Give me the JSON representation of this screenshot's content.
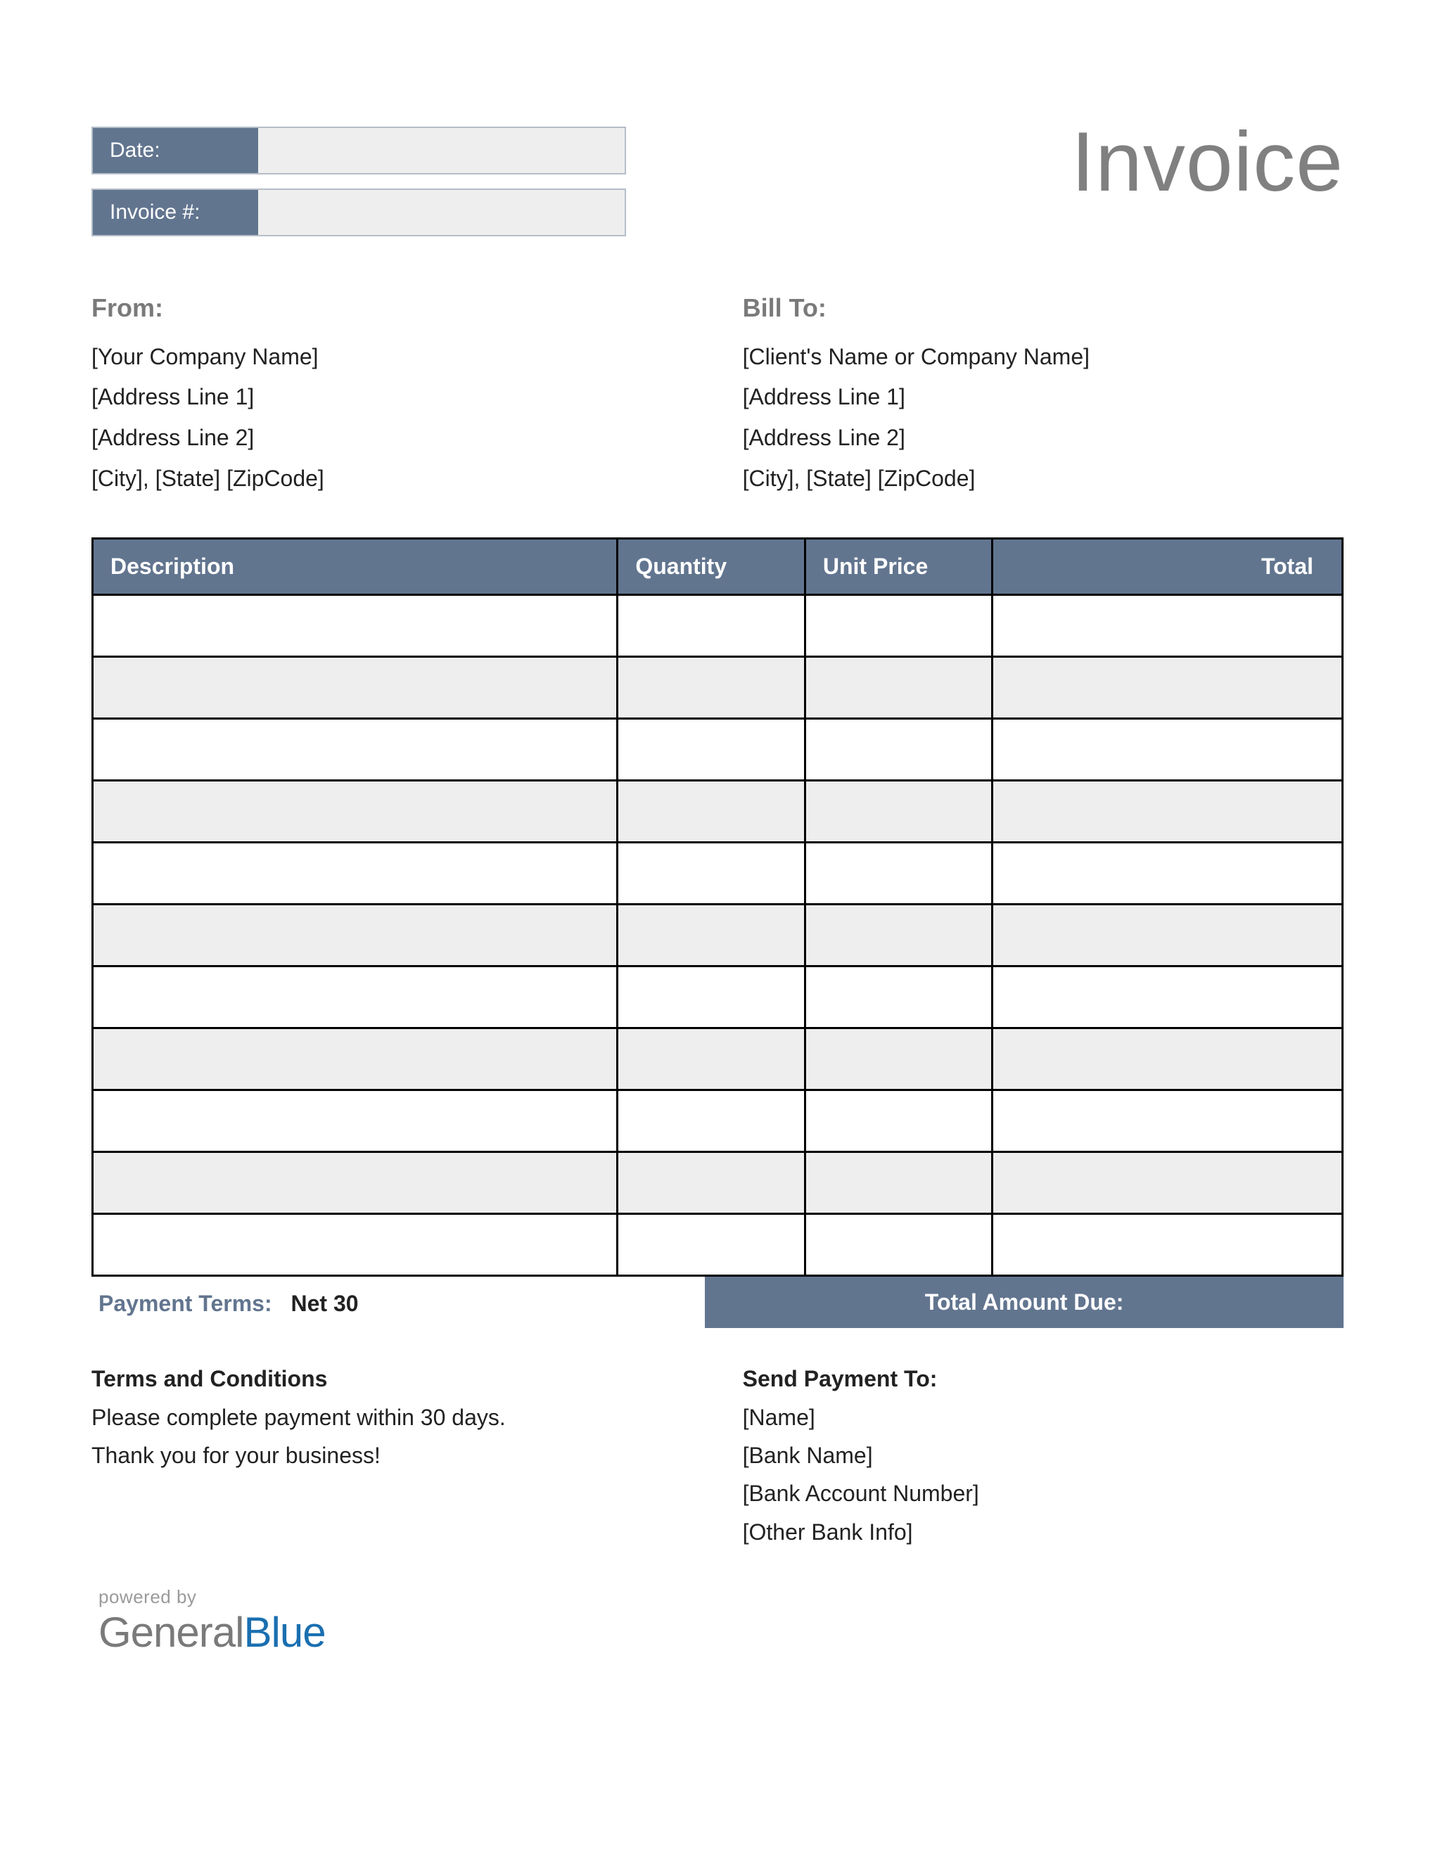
{
  "title": "Invoice",
  "meta": {
    "date_label": "Date:",
    "date_value": "",
    "invoice_no_label": "Invoice #:",
    "invoice_no_value": ""
  },
  "from": {
    "heading": "From:",
    "lines": [
      "[Your Company Name]",
      "[Address Line 1]",
      "[Address Line 2]",
      "[City], [State] [ZipCode]"
    ]
  },
  "bill_to": {
    "heading": "Bill To:",
    "lines": [
      "[Client's Name or Company Name]",
      "[Address Line 1]",
      "[Address Line 2]",
      "[City], [State] [ZipCode]"
    ]
  },
  "table": {
    "headers": [
      "Description",
      "Quantity",
      "Unit Price",
      "Total"
    ],
    "rows": [
      [
        "",
        "",
        "",
        ""
      ],
      [
        "",
        "",
        "",
        ""
      ],
      [
        "",
        "",
        "",
        ""
      ],
      [
        "",
        "",
        "",
        ""
      ],
      [
        "",
        "",
        "",
        ""
      ],
      [
        "",
        "",
        "",
        ""
      ],
      [
        "",
        "",
        "",
        ""
      ],
      [
        "",
        "",
        "",
        ""
      ],
      [
        "",
        "",
        "",
        ""
      ],
      [
        "",
        "",
        "",
        ""
      ],
      [
        "",
        "",
        "",
        ""
      ]
    ]
  },
  "payment_terms": {
    "label": "Payment Terms:",
    "value": "Net 30"
  },
  "total_due": {
    "label": "Total Amount Due:",
    "value": ""
  },
  "terms": {
    "heading": "Terms and Conditions",
    "lines": [
      "Please complete payment within 30 days.",
      "Thank you for your business!"
    ]
  },
  "send_payment_to": {
    "heading": "Send Payment To:",
    "lines": [
      "[Name]",
      "[Bank Name]",
      "[Bank Account Number]",
      "[Other Bank Info]"
    ]
  },
  "footer": {
    "powered_by": "powered by",
    "brand_part1": "General",
    "brand_part2": "Blue"
  }
}
